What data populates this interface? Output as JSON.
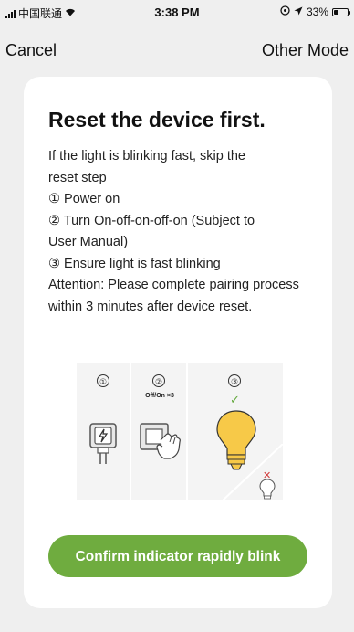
{
  "status_bar": {
    "carrier": "中国联通",
    "time": "3:38 PM",
    "battery": "33%",
    "battery_level": 0.33,
    "icons": [
      "signal-icon",
      "wifi-icon",
      "clock-icon",
      "location-icon",
      "battery-icon"
    ]
  },
  "nav": {
    "cancel_label": "Cancel",
    "other_mode_label": "Other Mode"
  },
  "card": {
    "title": "Reset the device first.",
    "lines": [
      "If the light is blinking fast, skip the",
      "reset step",
      "① Power on",
      "② Turn On-off-on-off-on (Subject to",
      "User Manual)",
      "③ Ensure light is fast blinking",
      "Attention: Please complete pairing process",
      "within 3 minutes after device reset."
    ],
    "illustration": {
      "step1_number": "①",
      "step2_number": "②",
      "step2_label": "Off/On ×3",
      "step3_number": "③",
      "icons": [
        "power-plug-icon",
        "light-switch-hand-icon",
        "check-icon",
        "light-bulb-on-icon",
        "cross-icon",
        "light-bulb-off-icon"
      ]
    },
    "confirm_label": "Confirm indicator rapidly blink"
  },
  "colors": {
    "accent_green": "#6fac3f",
    "bulb_yellow": "#f7c948",
    "background": "#efefef",
    "error_red": "#d23a3a"
  }
}
